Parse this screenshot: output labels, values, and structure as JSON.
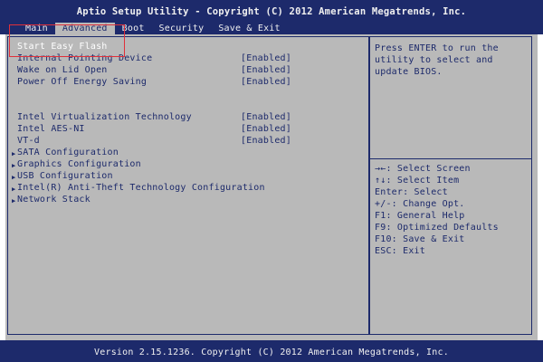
{
  "header": {
    "title": "Aptio Setup Utility - Copyright (C) 2012 American Megatrends, Inc.",
    "tabs": [
      {
        "label": "Main"
      },
      {
        "label": "Advanced"
      },
      {
        "label": "Boot"
      },
      {
        "label": "Security"
      },
      {
        "label": "Save & Exit"
      }
    ],
    "active_tab": "Advanced"
  },
  "menu": {
    "items": [
      {
        "label": "Start Easy Flash",
        "value": ""
      },
      {
        "label": "Internal Pointing Device",
        "value": "[Enabled]"
      },
      {
        "label": "Wake on Lid Open",
        "value": "[Enabled]"
      },
      {
        "label": "Power Off Energy Saving",
        "value": "[Enabled]"
      },
      {
        "label": "Intel Virtualization Technology",
        "value": "[Enabled]"
      },
      {
        "label": "Intel AES-NI",
        "value": "[Enabled]"
      },
      {
        "label": "VT-d",
        "value": "[Enabled]"
      },
      {
        "label": "SATA Configuration",
        "value": ""
      },
      {
        "label": "Graphics Configuration",
        "value": ""
      },
      {
        "label": "USB Configuration",
        "value": ""
      },
      {
        "label": "Intel(R) Anti-Theft Technology Configuration",
        "value": ""
      },
      {
        "label": "Network Stack",
        "value": ""
      }
    ],
    "selected": "Start Easy Flash"
  },
  "help": {
    "text": "Press ENTER to run the utility to select and update BIOS."
  },
  "keys": [
    "→←: Select Screen",
    "↑↓: Select Item",
    "Enter: Select",
    "+/-: Change Opt.",
    "F1: General Help",
    "F9: Optimized Defaults",
    "F10: Save & Exit",
    "ESC: Exit"
  ],
  "footer": {
    "text": "Version 2.15.1236. Copyright (C) 2012 American Megatrends, Inc."
  },
  "colors": {
    "header_bg": "#1d2a6b",
    "panel_bg": "#b9b9b9",
    "text": "#1d2a6b",
    "highlight_box": "#e0303a"
  }
}
